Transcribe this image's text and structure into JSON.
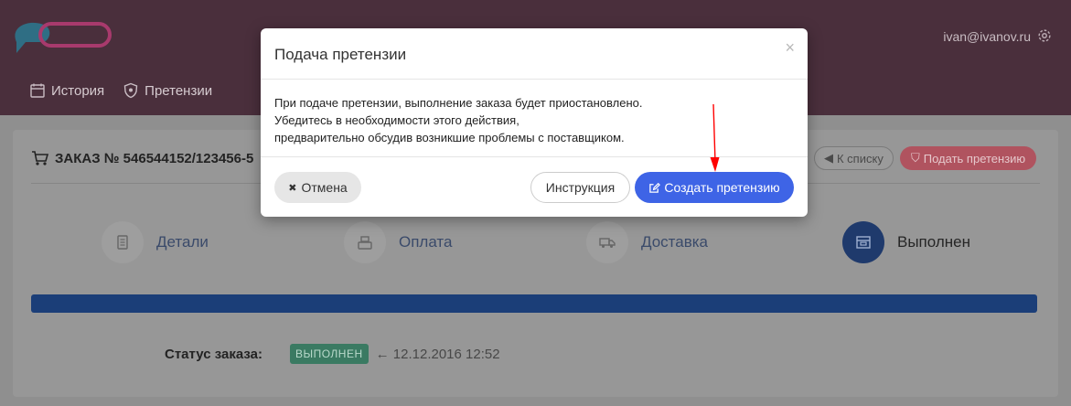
{
  "header": {
    "user_email": "ivan@ivanov.ru",
    "nav": [
      {
        "label": "История",
        "icon": "calendar-icon"
      },
      {
        "label": "Претензии",
        "icon": "shield-icon"
      }
    ]
  },
  "order": {
    "title": "ЗАКАЗ № 546544152/123456-5",
    "back_label": "К списку",
    "claim_label": "Подать претензию",
    "steps": [
      {
        "label": "Детали",
        "icon": "document-icon"
      },
      {
        "label": "Оплата",
        "icon": "cash-register-icon"
      },
      {
        "label": "Доставка",
        "icon": "truck-icon"
      },
      {
        "label": "Выполнен",
        "icon": "box-icon"
      }
    ],
    "status_label": "Статус заказа:",
    "status_badge": "ВЫПОЛНЕН",
    "status_date": "← 12.12.2016 12:52",
    "progress_fraction": 1.0
  },
  "modal": {
    "title": "Подача претензии",
    "close": "×",
    "body_lines": [
      "При подаче претензии, выполнение заказа будет приостановлено.",
      "Убедитесь в необходимости этого действия,",
      "предварительно обсудив возникшие проблемы с поставщиком."
    ],
    "cancel_label": "Отмена",
    "cancel_icon": "✖",
    "instruction_label": "Инструкция",
    "create_label": "Создать претензию"
  },
  "colors": {
    "header_bg": "#4a2f3c",
    "overlay_bg": "#8f8f8f",
    "primary": "#3e64e6",
    "danger": "#b0535f",
    "success": "#3a7a62",
    "annotation_arrow": "#ff0000"
  }
}
